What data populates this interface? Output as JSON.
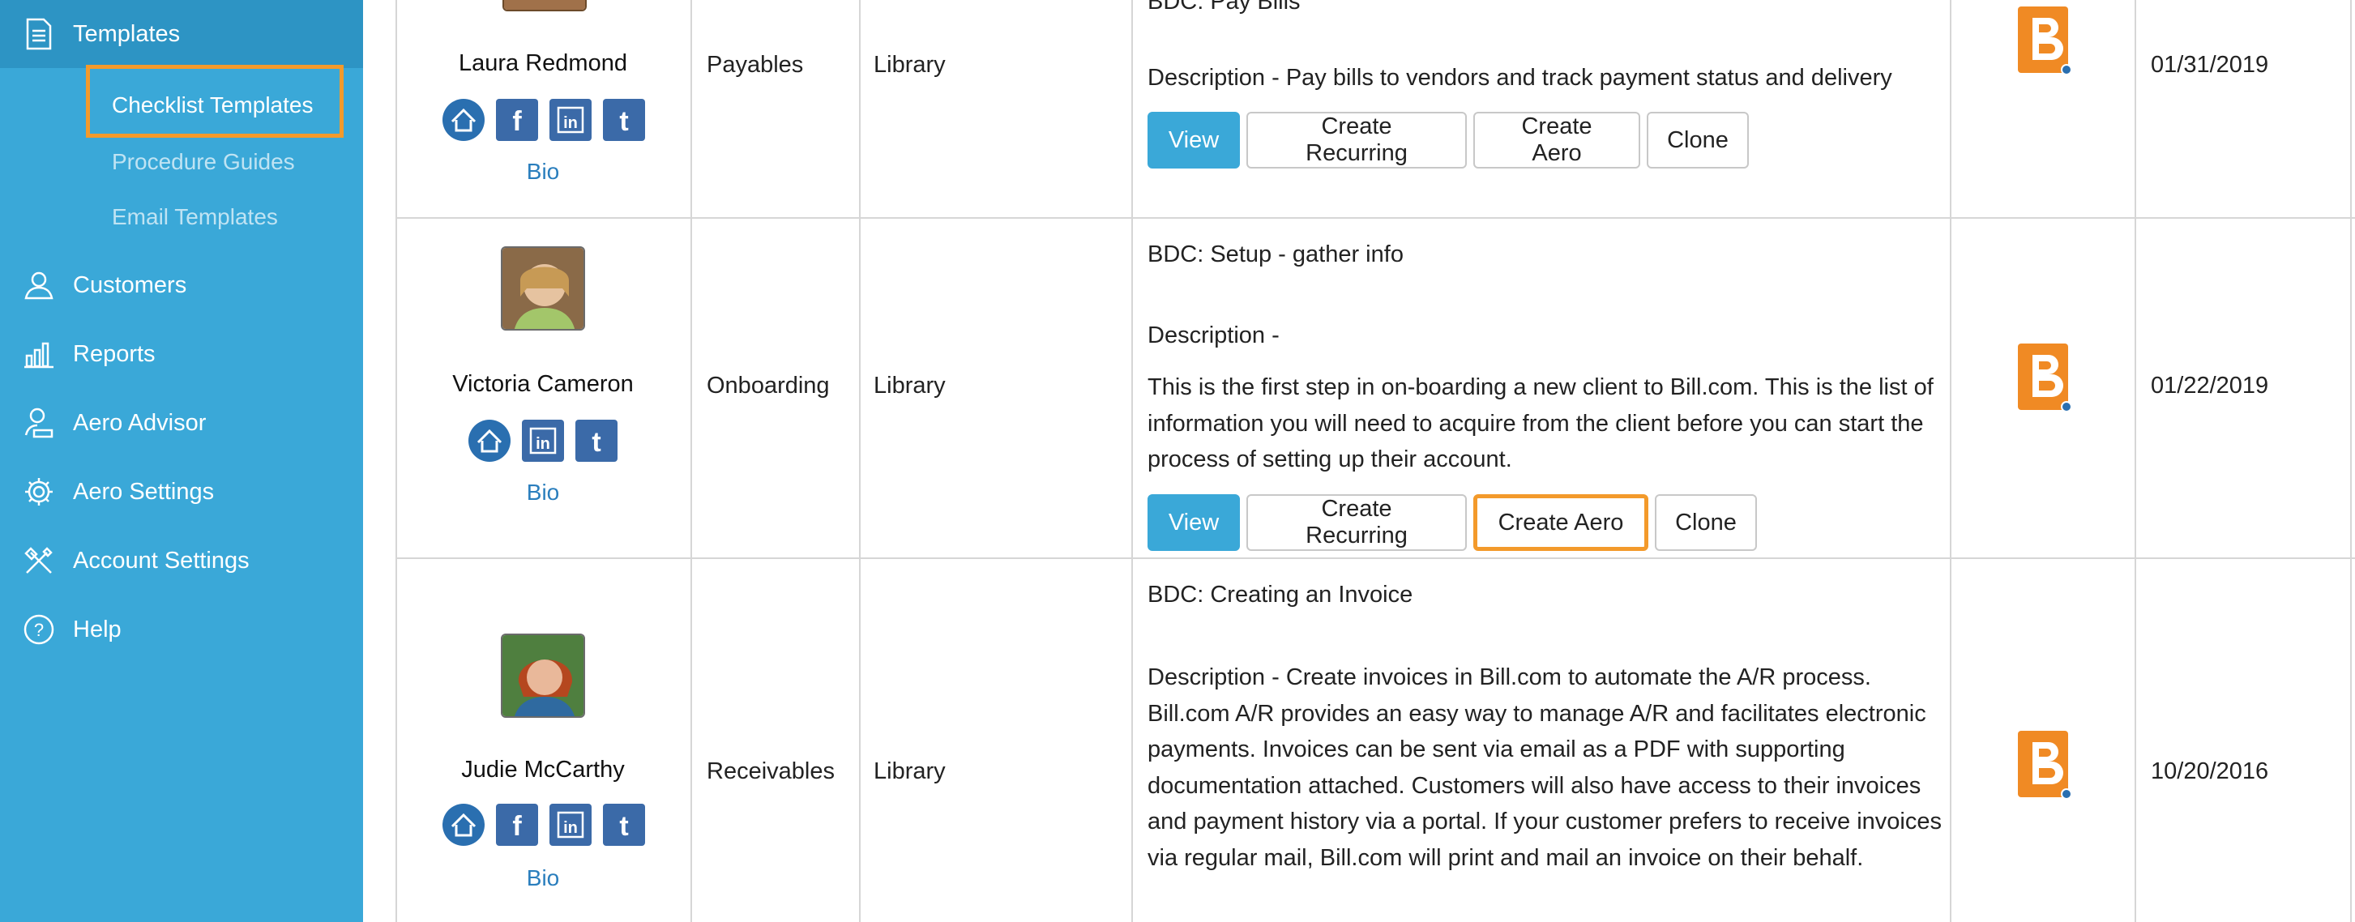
{
  "sidebar": {
    "templates_label": "Templates",
    "checklist_label": "Checklist Templates",
    "procedure_label": "Procedure Guides",
    "email_label": "Email Templates",
    "customers_label": "Customers",
    "reports_label": "Reports",
    "aero_advisor_label": "Aero Advisor",
    "aero_settings_label": "Aero Settings",
    "account_settings_label": "Account Settings",
    "help_label": "Help"
  },
  "actions": {
    "view": "View",
    "create_recurring": "Create Recurring",
    "create_aero": "Create Aero",
    "clone": "Clone"
  },
  "rows": [
    {
      "author": "Laura Redmond",
      "bio": "Bio",
      "category": "Payables",
      "source": "Library",
      "title": "BDC: Pay Bills",
      "description": "Description - Pay bills to vendors and track payment status and delivery",
      "date": "01/31/2019"
    },
    {
      "author": "Victoria Cameron",
      "bio": "Bio",
      "category": "Onboarding",
      "source": "Library",
      "title": "BDC: Setup - gather info",
      "description": "Description -",
      "description_body": "This is the first step in on-boarding a new client to Bill.com.  This is the list of information you will need to acquire from the client before you can start the process of setting up their account.",
      "date": "01/22/2019"
    },
    {
      "author": "Judie McCarthy",
      "bio": "Bio",
      "category": "Receivables",
      "source": "Library",
      "title": "BDC: Creating an Invoice",
      "description": "Description - Create invoices in Bill.com to automate the A/R process. Bill.com A/R provides an easy way to manage A/R and facilitates electronic payments. Invoices can be sent via email as a PDF with supporting documentation attached. Customers will also have access to their invoices and payment history via a portal. If your customer prefers to receive invoices via regular mail, Bill.com will print and mail an invoice on their behalf.",
      "date": "10/20/2016"
    }
  ],
  "colors": {
    "sidebar": "#3aa8d8",
    "sidebar_active": "#2d94c4",
    "highlight": "#f39a2b",
    "primary_button": "#3aa8d8",
    "link": "#2a7ebd",
    "brand": "#f08a24"
  },
  "icons": [
    "document-icon",
    "customers-icon",
    "reports-icon",
    "aero-advisor-icon",
    "settings-gear-icon",
    "tools-icon",
    "help-icon",
    "home-social-icon",
    "facebook-icon",
    "linkedin-icon",
    "twitter-icon",
    "bill-com-logo-icon"
  ]
}
